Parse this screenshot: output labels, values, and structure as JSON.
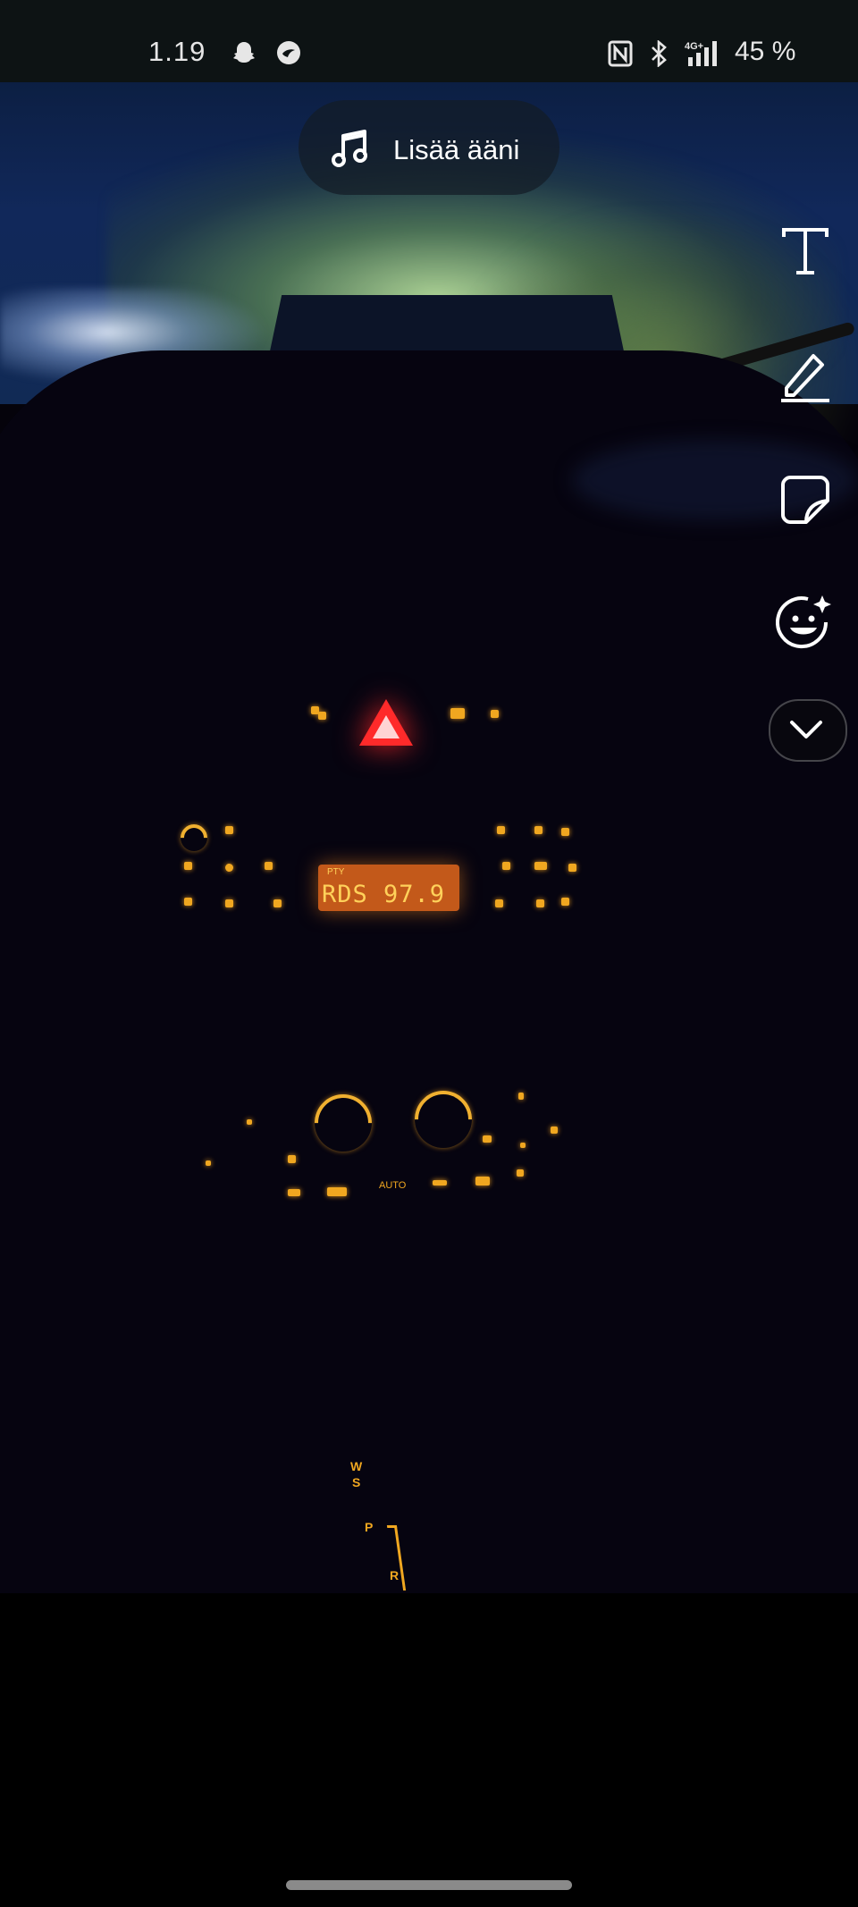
{
  "status_bar": {
    "time": "1.19",
    "left_icons": [
      "snapchat-icon",
      "app-notification-icon"
    ],
    "right_icons": [
      "nfc-icon",
      "bluetooth-icon",
      "signal-4g-icon"
    ],
    "network": "4G+",
    "battery": "45 %"
  },
  "toolbar": {
    "add_sound_label": "Lisää ääni",
    "tools": [
      "text-tool-icon",
      "pen-tool-icon",
      "sticker-tool-icon",
      "emoji-effect-icon",
      "chevron-down-icon"
    ]
  },
  "photo": {
    "radio_display": {
      "top_small": "PTY",
      "main": "RDS   97.9"
    },
    "climate_labels": [
      "AUTO"
    ],
    "gear_labels": [
      "W",
      "S",
      "P",
      "R"
    ]
  },
  "colors": {
    "status_bar_bg": "#0d1314",
    "console_amber": "#f0a720",
    "hazard_red": "#ff2a2a",
    "sky_blue": "#11285a"
  }
}
